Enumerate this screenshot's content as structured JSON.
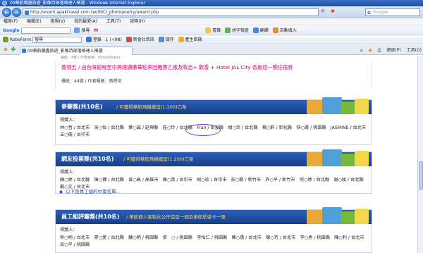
{
  "window": {
    "title": "09華航職盡旅遊_影像詩部落格達人徵選 - Windows Internet Explorer"
  },
  "addressbar": {
    "url": "http://event.apaktravel.com.tw/09CI_photopoetry/award.php",
    "search_placeholder": "Google"
  },
  "menubar": {
    "items": [
      "檔案(F)",
      "編輯(E)",
      "檢視(V)",
      "我的最愛(A)",
      "工具(T)",
      "說明(H)"
    ]
  },
  "toolbar1": {
    "logo": "Google",
    "search_label": "搜尋",
    "items": [
      "書籤",
      "拼字檢查",
      "翻譯",
      "自動填入"
    ]
  },
  "toolbar2": {
    "roboform": "RoboForm",
    "search_value": "搜尋",
    "items": [
      "登錄",
      "1 (+98)",
      "新會社資訊",
      "儲存",
      "產生密碼"
    ]
  },
  "tabs": [
    {
      "label": "09華航職盡旅遊_影像詩部落格達人徵選"
    }
  ],
  "commandbar": {
    "items": [
      "網頁(P)",
      "工具(O)"
    ]
  },
  "page": {
    "top_fragment": "攝紙：4號 / 作者暱稱：Honeyflower",
    "promo_text": "獎項五 / 由台灣館程至中興總讚繳華點來回機票乙張及牧志+ 歡香 + Hotel JAL City 各飯店一晚住宿券",
    "promo_author": "攝紙：44號 / 作者暱稱：燕賢倍"
  },
  "sections": [
    {
      "title": "參賽獎(共10名)",
      "subtitle": "/ 可獲得華航飛機模型(1:200)乙架",
      "winners_label": "得獎人：",
      "lines": [
        "林○哲 / 台北市　吳○怡 / 台北縣　葉○誠 / 延興縣　莊○玲 / 台北縣　Fran / 南投縣　胡○玲 / 台北縣　楊○軒 / 彰化縣　快○霞 / 桃園縣　JASMINE / 台北市",
        "王○儒 / 台中市"
      ]
    },
    {
      "title": "網友投票獎(共10名)",
      "subtitle": "/ 可獲得華航飛機模型(1:200)乙架",
      "winners_label": "得獎人：",
      "lines": [
        "陳○婷 / 台北縣　陳○揮 / 台北縣　曾○高 / 高雄市　陳○萊 / 台中市　胡○珍 / 台中市　彭○騏 / 新竹市　許○平 / 新竹市　何○婷 / 台北縣　謝○綾 / 台北縣",
        "戴○文 / 台北市"
      ]
    },
    {
      "title": "員工組評審獎(共10名)",
      "subtitle": "/ 華航個人客製化公仔造型一個及華航愁遊卡一張",
      "winners_label": "得獎人：",
      "lines": [
        "熊○翔 / 台北市　廖○愛 / 台北縣　輔○明 / 桃園縣　張　○ / 桃園縣　李怡仁 / 桃園縣　陳○惠 / 台北市　陳○芳 / 台北市　李○男 / 桃園縣　陳○利 / 台北市",
        "呂○平 / 桃園縣"
      ]
    }
  ],
  "employee_link": "以下是員工組的中獎名單..."
}
